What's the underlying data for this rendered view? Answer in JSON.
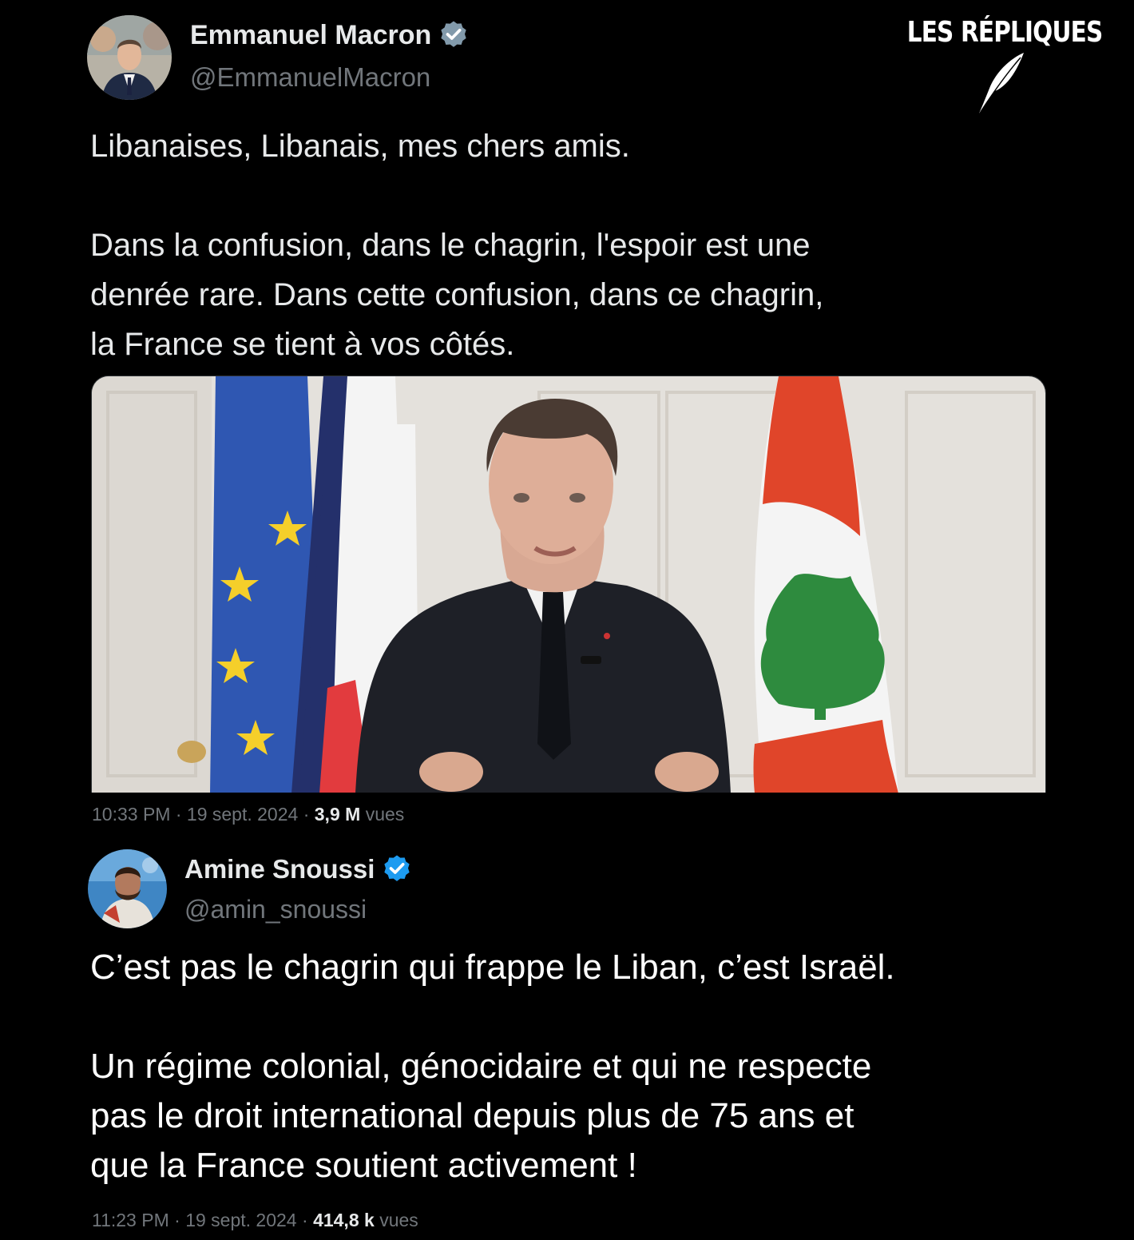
{
  "watermark": {
    "text": "LES RÉPLIQUES",
    "icon": "quill-icon"
  },
  "tweet1": {
    "author_name": "Emmanuel Macron",
    "handle": "@EmmanuelMacron",
    "verified_icon": "verified-badge-icon",
    "badge_color": "#829aab",
    "text": "Libanaises, Libanais, mes chers amis.\n\nDans la confusion, dans le chagrin, l'espoir est une\ndenrée rare. Dans cette confusion, dans ce chagrin,\nla France se tient à vos côtés.",
    "time": "10:33 PM",
    "date": "19 sept. 2024",
    "views_count": "3,9 M",
    "views_label": "vues",
    "sep": "·"
  },
  "tweet2": {
    "author_name": "Amine Snoussi",
    "handle": "@amin_snoussi",
    "verified_icon": "verified-badge-icon",
    "badge_color": "#1d9bf0",
    "text": "C’est pas le chagrin qui frappe le Liban, c’est Israël.\n\nUn régime colonial, génocidaire et qui ne respecte\npas le droit international depuis plus de 75 ans et\nque la France soutient activement !",
    "time": "11:23 PM",
    "date": "19 sept. 2024",
    "views_count": "414,8 k",
    "views_label": "vues",
    "sep": "·"
  }
}
